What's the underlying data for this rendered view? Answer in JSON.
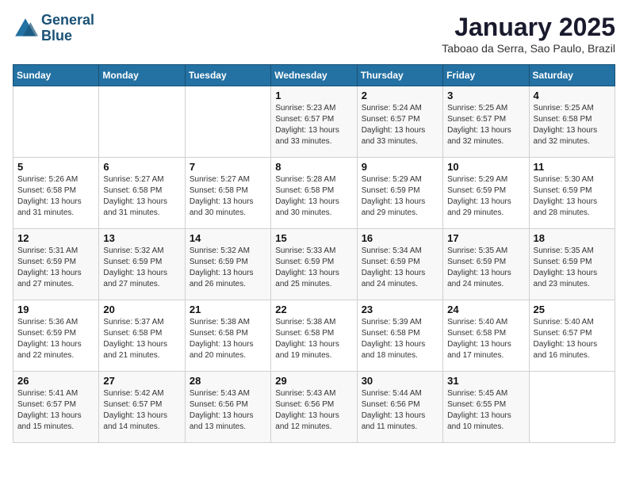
{
  "header": {
    "logo_line1": "General",
    "logo_line2": "Blue",
    "month": "January 2025",
    "location": "Taboao da Serra, Sao Paulo, Brazil"
  },
  "days_of_week": [
    "Sunday",
    "Monday",
    "Tuesday",
    "Wednesday",
    "Thursday",
    "Friday",
    "Saturday"
  ],
  "weeks": [
    [
      {
        "day": "",
        "info": ""
      },
      {
        "day": "",
        "info": ""
      },
      {
        "day": "",
        "info": ""
      },
      {
        "day": "1",
        "info": "Sunrise: 5:23 AM\nSunset: 6:57 PM\nDaylight: 13 hours\nand 33 minutes."
      },
      {
        "day": "2",
        "info": "Sunrise: 5:24 AM\nSunset: 6:57 PM\nDaylight: 13 hours\nand 33 minutes."
      },
      {
        "day": "3",
        "info": "Sunrise: 5:25 AM\nSunset: 6:57 PM\nDaylight: 13 hours\nand 32 minutes."
      },
      {
        "day": "4",
        "info": "Sunrise: 5:25 AM\nSunset: 6:58 PM\nDaylight: 13 hours\nand 32 minutes."
      }
    ],
    [
      {
        "day": "5",
        "info": "Sunrise: 5:26 AM\nSunset: 6:58 PM\nDaylight: 13 hours\nand 31 minutes."
      },
      {
        "day": "6",
        "info": "Sunrise: 5:27 AM\nSunset: 6:58 PM\nDaylight: 13 hours\nand 31 minutes."
      },
      {
        "day": "7",
        "info": "Sunrise: 5:27 AM\nSunset: 6:58 PM\nDaylight: 13 hours\nand 30 minutes."
      },
      {
        "day": "8",
        "info": "Sunrise: 5:28 AM\nSunset: 6:58 PM\nDaylight: 13 hours\nand 30 minutes."
      },
      {
        "day": "9",
        "info": "Sunrise: 5:29 AM\nSunset: 6:59 PM\nDaylight: 13 hours\nand 29 minutes."
      },
      {
        "day": "10",
        "info": "Sunrise: 5:29 AM\nSunset: 6:59 PM\nDaylight: 13 hours\nand 29 minutes."
      },
      {
        "day": "11",
        "info": "Sunrise: 5:30 AM\nSunset: 6:59 PM\nDaylight: 13 hours\nand 28 minutes."
      }
    ],
    [
      {
        "day": "12",
        "info": "Sunrise: 5:31 AM\nSunset: 6:59 PM\nDaylight: 13 hours\nand 27 minutes."
      },
      {
        "day": "13",
        "info": "Sunrise: 5:32 AM\nSunset: 6:59 PM\nDaylight: 13 hours\nand 27 minutes."
      },
      {
        "day": "14",
        "info": "Sunrise: 5:32 AM\nSunset: 6:59 PM\nDaylight: 13 hours\nand 26 minutes."
      },
      {
        "day": "15",
        "info": "Sunrise: 5:33 AM\nSunset: 6:59 PM\nDaylight: 13 hours\nand 25 minutes."
      },
      {
        "day": "16",
        "info": "Sunrise: 5:34 AM\nSunset: 6:59 PM\nDaylight: 13 hours\nand 24 minutes."
      },
      {
        "day": "17",
        "info": "Sunrise: 5:35 AM\nSunset: 6:59 PM\nDaylight: 13 hours\nand 24 minutes."
      },
      {
        "day": "18",
        "info": "Sunrise: 5:35 AM\nSunset: 6:59 PM\nDaylight: 13 hours\nand 23 minutes."
      }
    ],
    [
      {
        "day": "19",
        "info": "Sunrise: 5:36 AM\nSunset: 6:59 PM\nDaylight: 13 hours\nand 22 minutes."
      },
      {
        "day": "20",
        "info": "Sunrise: 5:37 AM\nSunset: 6:58 PM\nDaylight: 13 hours\nand 21 minutes."
      },
      {
        "day": "21",
        "info": "Sunrise: 5:38 AM\nSunset: 6:58 PM\nDaylight: 13 hours\nand 20 minutes."
      },
      {
        "day": "22",
        "info": "Sunrise: 5:38 AM\nSunset: 6:58 PM\nDaylight: 13 hours\nand 19 minutes."
      },
      {
        "day": "23",
        "info": "Sunrise: 5:39 AM\nSunset: 6:58 PM\nDaylight: 13 hours\nand 18 minutes."
      },
      {
        "day": "24",
        "info": "Sunrise: 5:40 AM\nSunset: 6:58 PM\nDaylight: 13 hours\nand 17 minutes."
      },
      {
        "day": "25",
        "info": "Sunrise: 5:40 AM\nSunset: 6:57 PM\nDaylight: 13 hours\nand 16 minutes."
      }
    ],
    [
      {
        "day": "26",
        "info": "Sunrise: 5:41 AM\nSunset: 6:57 PM\nDaylight: 13 hours\nand 15 minutes."
      },
      {
        "day": "27",
        "info": "Sunrise: 5:42 AM\nSunset: 6:57 PM\nDaylight: 13 hours\nand 14 minutes."
      },
      {
        "day": "28",
        "info": "Sunrise: 5:43 AM\nSunset: 6:56 PM\nDaylight: 13 hours\nand 13 minutes."
      },
      {
        "day": "29",
        "info": "Sunrise: 5:43 AM\nSunset: 6:56 PM\nDaylight: 13 hours\nand 12 minutes."
      },
      {
        "day": "30",
        "info": "Sunrise: 5:44 AM\nSunset: 6:56 PM\nDaylight: 13 hours\nand 11 minutes."
      },
      {
        "day": "31",
        "info": "Sunrise: 5:45 AM\nSunset: 6:55 PM\nDaylight: 13 hours\nand 10 minutes."
      },
      {
        "day": "",
        "info": ""
      }
    ]
  ]
}
